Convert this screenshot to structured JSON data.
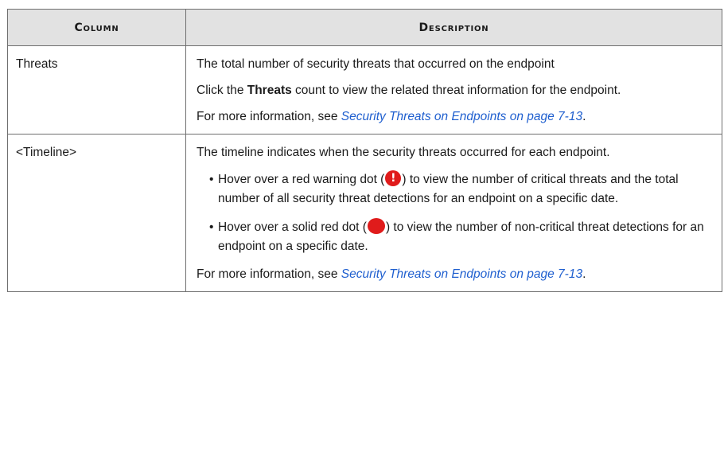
{
  "table": {
    "headers": [
      "Column",
      "Description"
    ],
    "rows": [
      {
        "column": "Threats",
        "description": {
          "p1": "The total number of security threats that occurred on the endpoint",
          "p2_pre": "Click the ",
          "p2_bold": "Threats",
          "p2_post": " count to view the related threat information for the endpoint.",
          "p3_pre": "For more information, see ",
          "p3_link": "Security Threats on Endpoints on page 7-13",
          "p3_post": "."
        }
      },
      {
        "column": "<Timeline>",
        "description": {
          "p1": "The timeline indicates when the security threats occurred for each endpoint.",
          "bullets": [
            {
              "pre": "Hover over a red warning dot (",
              "icon": "red-warning-dot-icon",
              "post": ") to view the number of critical threats and the total number of all security threat detections for an endpoint on a specific date."
            },
            {
              "pre": "Hover over a solid red dot (",
              "icon": "solid-red-dot-icon",
              "post": ") to view the number of non-critical threat detections for an endpoint on a specific date."
            }
          ],
          "p_last_pre": "For more information, see ",
          "p_last_link": "Security Threats on Endpoints on page 7-13",
          "p_last_post": "."
        }
      }
    ]
  },
  "colors": {
    "header_bg": "#e2e2e2",
    "border": "#6f6f6f",
    "link": "#1f5fcf",
    "dot_red": "#e01b1b"
  }
}
